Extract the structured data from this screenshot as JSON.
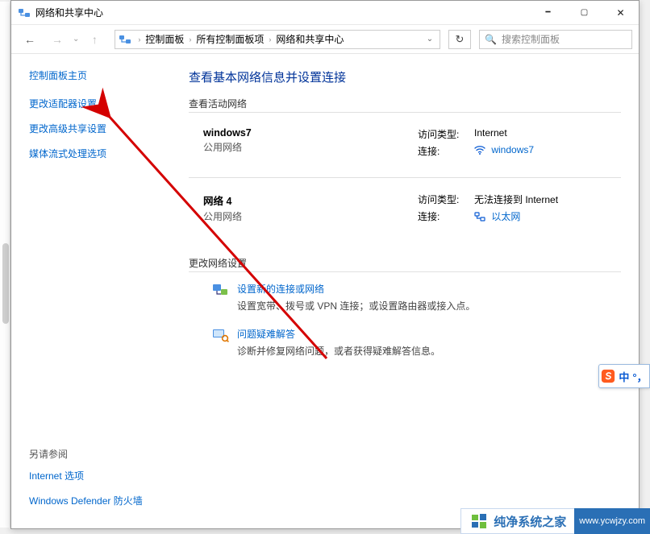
{
  "window": {
    "title": "网络和共享中心"
  },
  "nav": {
    "crumbs": [
      "控制面板",
      "所有控制面板项",
      "网络和共享中心"
    ],
    "search_placeholder": "搜索控制面板"
  },
  "sidebar": {
    "home": "控制面板主页",
    "links": [
      "更改适配器设置",
      "更改高级共享设置",
      "媒体流式处理选项"
    ],
    "others_title": "另请参阅",
    "others": [
      "Internet 选项",
      "Windows Defender 防火墙"
    ]
  },
  "content": {
    "heading": "查看基本网络信息并设置连接",
    "active_title": "查看活动网络",
    "networks": [
      {
        "name": "windows7",
        "kind": "公用网络",
        "access_label": "访问类型:",
        "access_value": "Internet",
        "conn_label": "连接:",
        "conn_link": "windows7",
        "conn_icon": "wifi"
      },
      {
        "name": "网络 4",
        "kind": "公用网络",
        "access_label": "访问类型:",
        "access_value": "无法连接到 Internet",
        "conn_label": "连接:",
        "conn_link": "以太网",
        "conn_icon": "ethernet"
      }
    ],
    "change_title": "更改网络设置",
    "actions": [
      {
        "title": "设置新的连接或网络",
        "desc": "设置宽带、拨号或 VPN 连接；或设置路由器或接入点。",
        "icon": "new-conn"
      },
      {
        "title": "问题疑难解答",
        "desc": "诊断并修复网络问题，或者获得疑难解答信息。",
        "icon": "troubleshoot"
      }
    ]
  },
  "ime": {
    "text": "中"
  },
  "watermark": {
    "brand": "纯净系统之家",
    "url": "www.ycwjzy.com"
  }
}
